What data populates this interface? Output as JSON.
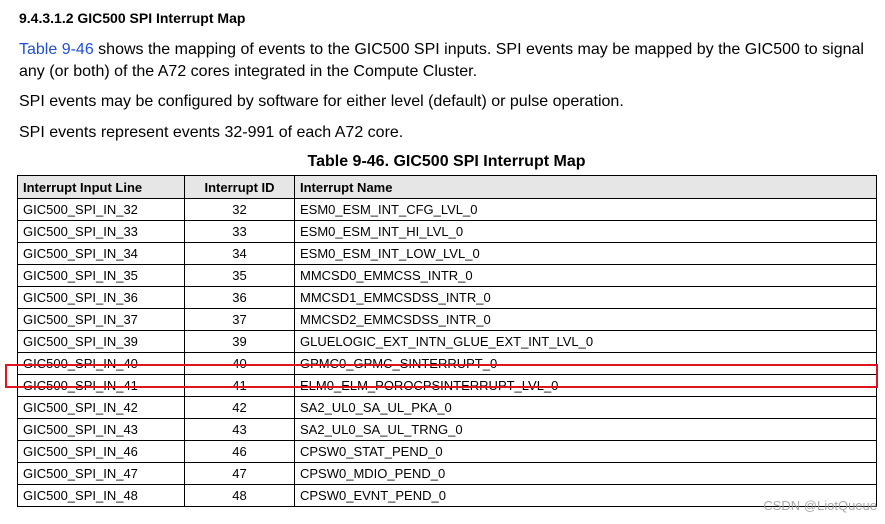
{
  "section_heading": "9.4.3.1.2 GIC500 SPI Interrupt Map",
  "paragraphs": {
    "p1_link": "Table 9-46",
    "p1_rest": " shows the mapping of events to the GIC500 SPI inputs. SPI events may be mapped by the GIC500 to signal any (or both) of the A72 cores integrated in the Compute Cluster.",
    "p2": "SPI events may be configured by software for either level (default) or pulse operation.",
    "p3": "SPI events represent events 32-991 of each A72 core."
  },
  "table": {
    "caption": "Table 9-46. GIC500 SPI Interrupt Map",
    "headers": [
      "Interrupt Input Line",
      "Interrupt ID",
      "Interrupt Name"
    ],
    "rows": [
      [
        "GIC500_SPI_IN_32",
        "32",
        "ESM0_ESM_INT_CFG_LVL_0"
      ],
      [
        "GIC500_SPI_IN_33",
        "33",
        "ESM0_ESM_INT_HI_LVL_0"
      ],
      [
        "GIC500_SPI_IN_34",
        "34",
        "ESM0_ESM_INT_LOW_LVL_0"
      ],
      [
        "GIC500_SPI_IN_35",
        "35",
        "MMCSD0_EMMCSS_INTR_0"
      ],
      [
        "GIC500_SPI_IN_36",
        "36",
        "MMCSD1_EMMCSDSS_INTR_0"
      ],
      [
        "GIC500_SPI_IN_37",
        "37",
        "MMCSD2_EMMCSDSS_INTR_0"
      ],
      [
        "GIC500_SPI_IN_39",
        "39",
        "GLUELOGIC_EXT_INTN_GLUE_EXT_INT_LVL_0"
      ],
      [
        "GIC500_SPI_IN_40",
        "40",
        "GPMC0_GPMC_SINTERRUPT_0"
      ],
      [
        "GIC500_SPI_IN_41",
        "41",
        "ELM0_ELM_POROCPSINTERRUPT_LVL_0"
      ],
      [
        "GIC500_SPI_IN_42",
        "42",
        "SA2_UL0_SA_UL_PKA_0"
      ],
      [
        "GIC500_SPI_IN_43",
        "43",
        "SA2_UL0_SA_UL_TRNG_0"
      ],
      [
        "GIC500_SPI_IN_46",
        "46",
        "CPSW0_STAT_PEND_0"
      ],
      [
        "GIC500_SPI_IN_47",
        "47",
        "CPSW0_MDIO_PEND_0"
      ],
      [
        "GIC500_SPI_IN_48",
        "48",
        "CPSW0_EVNT_PEND_0"
      ]
    ],
    "highlighted_row_id": "40"
  },
  "colors": {
    "link": "#1f4fd8",
    "highlight": "#e0141e",
    "header_bg": "#e6e6e6"
  },
  "watermark": "CSDN @LiotQueue"
}
